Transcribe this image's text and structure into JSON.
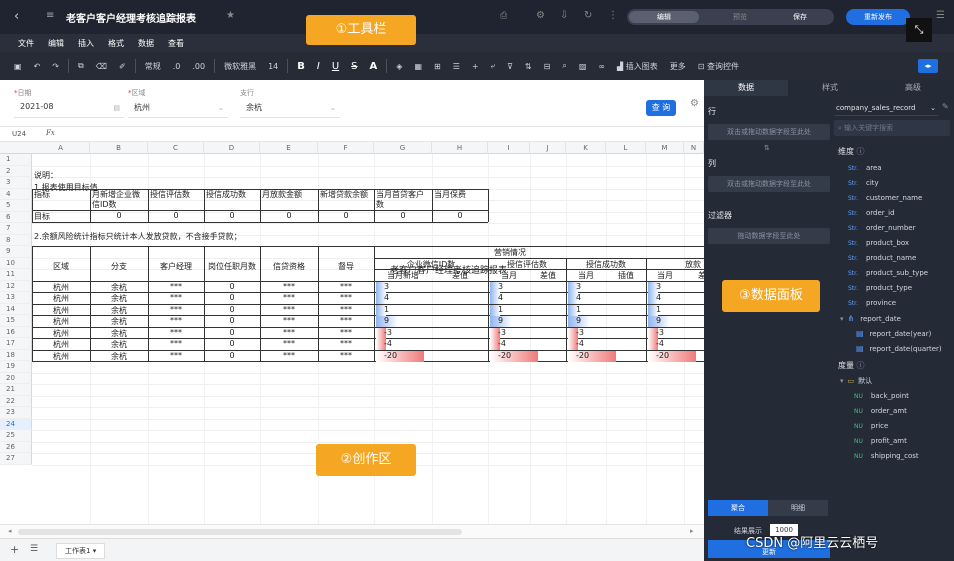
{
  "titlebar": {
    "back_icon": "chevron-left-icon",
    "title": "老客户客户经理考核追踪报表",
    "star_icon": "star-icon",
    "edit_label": "编辑",
    "preview_label": "预览",
    "save_label": "保存",
    "publish_label": "重新发布",
    "expand_icon": "expand-icon"
  },
  "menubar": {
    "items": [
      "文件",
      "编辑",
      "插入",
      "格式",
      "数据",
      "查看"
    ]
  },
  "toolbar": {
    "format_label": "常规",
    "font_family": "微软雅黑",
    "font_size": "14",
    "insert_chart_label": "插入图表",
    "more_label": "更多",
    "query_control_label": "查询控件"
  },
  "callouts": {
    "toolbar": "①工具栏",
    "canvas": "②创作区",
    "data_panel": "③数据面板"
  },
  "filters": {
    "date_label": "日期",
    "date_value": "2021-08",
    "region_label": "区域",
    "region_value": "杭州",
    "branch_label": "支行",
    "branch_value": "余杭",
    "query_label": "查 询"
  },
  "formula_bar": {
    "cell_ref": "U24",
    "fx": "Fx"
  },
  "grid": {
    "columns": [
      "A",
      "B",
      "C",
      "D",
      "E",
      "F",
      "G",
      "H",
      "I",
      "J",
      "K",
      "L",
      "M",
      "N"
    ],
    "rows": [
      "1",
      "2",
      "3",
      "4",
      "5",
      "6",
      "7",
      "8",
      "9",
      "10",
      "11",
      "12",
      "13",
      "14",
      "15",
      "16",
      "17",
      "18",
      "19",
      "20",
      "21",
      "22",
      "23",
      "24",
      "25",
      "26",
      "27"
    ],
    "selected_row": "24",
    "notes": {
      "title": "说明：",
      "line1": "1.报表使用目标值",
      "line2": "2.余额风险统计指标只统计本人发放贷款，不含接手贷款；"
    },
    "target_table": {
      "headers": [
        "指标",
        "月新增企业微信ID数",
        "授信评估数",
        "授信成功数",
        "月放款金额",
        "新增贷款余额",
        "当月首贷客户数",
        "当月保费"
      ],
      "row_label": "目标",
      "values": [
        "0",
        "0",
        "0",
        "0",
        "0",
        "0",
        "0"
      ]
    },
    "report_title": "老客户客户经理考核追踪报表",
    "report": {
      "h_region": "区域",
      "h_branch": "分支",
      "h_manager": "客户经理",
      "h_months": "岗位任职月数",
      "h_credit": "信贷资格",
      "h_supervisor": "督导",
      "h_marketing": "营销情况",
      "h_wechat": "企业微信ID数",
      "h_credit_eval": "授信评估数",
      "h_credit_success": "授信成功数",
      "h_loan": "放款",
      "sub_headers": [
        "当月新增",
        "差值",
        "当月",
        "差值",
        "当月",
        "插值",
        "当月",
        "差"
      ],
      "rows": [
        {
          "region": "杭州",
          "branch": "余杭",
          "manager": "***",
          "months": "0",
          "credit": "***",
          "supervisor": "***",
          "v": "3"
        },
        {
          "region": "杭州",
          "branch": "余杭",
          "manager": "***",
          "months": "0",
          "credit": "***",
          "supervisor": "***",
          "v": "4"
        },
        {
          "region": "杭州",
          "branch": "余杭",
          "manager": "***",
          "months": "0",
          "credit": "***",
          "supervisor": "***",
          "v": "1"
        },
        {
          "region": "杭州",
          "branch": "余杭",
          "manager": "***",
          "months": "0",
          "credit": "***",
          "supervisor": "***",
          "v": "9"
        },
        {
          "region": "杭州",
          "branch": "余杭",
          "manager": "***",
          "months": "0",
          "credit": "***",
          "supervisor": "***",
          "v": "-3"
        },
        {
          "region": "杭州",
          "branch": "余杭",
          "manager": "***",
          "months": "0",
          "credit": "***",
          "supervisor": "***",
          "v": "-4"
        },
        {
          "region": "杭州",
          "branch": "余杭",
          "manager": "***",
          "months": "0",
          "credit": "***",
          "supervisor": "***",
          "v": "-20"
        }
      ]
    }
  },
  "sheetbar": {
    "sheet_name": "工作表1"
  },
  "panel": {
    "tabs": [
      "数据",
      "样式",
      "高级"
    ],
    "row_label": "行",
    "row_slot": "双击或拖动数据字段至此处",
    "col_label": "列",
    "col_slot": "双击或拖动数据字段至此处",
    "filter_label": "过滤器",
    "filter_slot": "拖动数据字段至此处",
    "dataset": "company_sales_record",
    "search_placeholder": "输入关键字搜索",
    "dimension_label": "维度",
    "dimensions": [
      "area",
      "city",
      "customer_name",
      "order_id",
      "order_number",
      "product_box",
      "product_name",
      "product_sub_type",
      "product_type",
      "province"
    ],
    "report_date": "report_date",
    "report_date_children": [
      "report_date(year)",
      "report_date(quarter)"
    ],
    "measure_label": "度量",
    "measure_group": "默认",
    "measures": [
      "back_point",
      "order_amt",
      "price",
      "profit_amt",
      "shipping_cost"
    ],
    "mode_aggregate": "聚合",
    "mode_detail": "明细",
    "result_display_label": "结果展示",
    "result_count": "1000",
    "update_label": "更新",
    "watermark": "CSDN @阿里云云栖号",
    "dim_tag": "Str.",
    "mea_tag": "NU"
  },
  "colors": {
    "accent": "#1f6fe0",
    "callout": "#f5a623",
    "panel_bg": "#242a36",
    "bar_positive": "#8fb4ee",
    "bar_negative": "#f07a7a"
  }
}
